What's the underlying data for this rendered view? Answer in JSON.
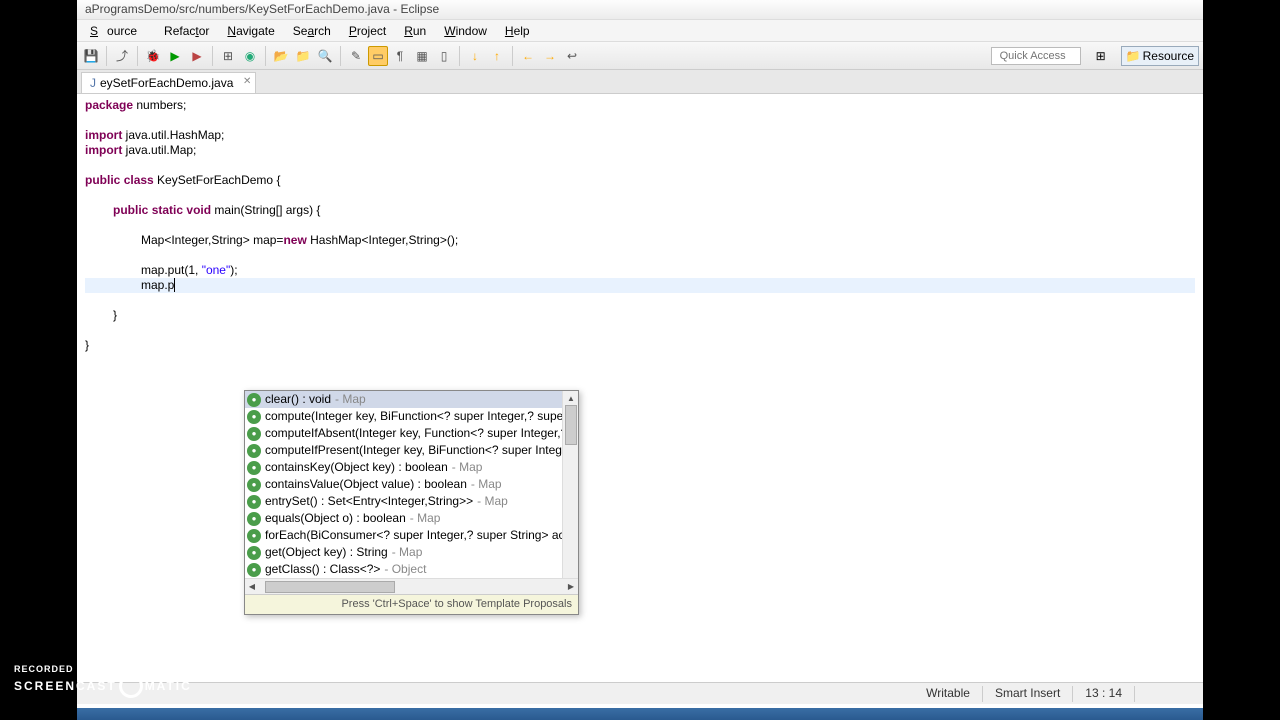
{
  "title": "aProgramsDemo/src/numbers/KeySetForEachDemo.java - Eclipse",
  "menus": [
    "Source",
    "Refactor",
    "Navigate",
    "Search",
    "Project",
    "Run",
    "Window",
    "Help"
  ],
  "quick_access_placeholder": "Quick Access",
  "perspective_label": "Resource",
  "tab": {
    "label": "eySetForEachDemo.java"
  },
  "code": {
    "l1": {
      "a": "package",
      "b": " numbers;"
    },
    "l2": {
      "a": "import",
      "b": " java.util.HashMap;"
    },
    "l3": {
      "a": "import",
      "b": " java.util.Map;"
    },
    "l4": {
      "a": "public",
      "b": " ",
      "c": "class",
      "d": " KeySetForEachDemo {"
    },
    "l5": {
      "a": "public",
      "b": " ",
      "c": "static",
      "d": " ",
      "e": "void",
      "f": " main(String[] args) {"
    },
    "l6": {
      "a": "Map<Integer,String> map=",
      "b": "new",
      "c": " HashMap<Integer,String>();"
    },
    "l7": {
      "a": "map.put(1, ",
      "b": "\"one\"",
      "c": ");"
    },
    "l8": {
      "a": "map.p"
    },
    "l9": "}",
    "l10": "}"
  },
  "completions": [
    {
      "sig": "clear() : void",
      "type": " - Map",
      "sel": true
    },
    {
      "sig": "compute(Integer key, BiFunction<? super Integer,? super",
      "type": ""
    },
    {
      "sig": "computeIfAbsent(Integer key, Function<? super Integer,?",
      "type": ""
    },
    {
      "sig": "computeIfPresent(Integer key, BiFunction<? super Integer",
      "type": ""
    },
    {
      "sig": "containsKey(Object key) : boolean",
      "type": " - Map"
    },
    {
      "sig": "containsValue(Object value) : boolean",
      "type": " - Map"
    },
    {
      "sig": "entrySet() : Set<Entry<Integer,String>>",
      "type": " - Map"
    },
    {
      "sig": "equals(Object o) : boolean",
      "type": " - Map"
    },
    {
      "sig": "forEach(BiConsumer<? super Integer,? super String> actio",
      "type": ""
    },
    {
      "sig": "get(Object key) : String",
      "type": " - Map"
    },
    {
      "sig": "getClass() : Class<?>",
      "type": " - Object"
    }
  ],
  "popup_hint": "Press 'Ctrl+Space' to show Template Proposals",
  "status": {
    "writable": "Writable",
    "insert": "Smart Insert",
    "pos": "13 : 14"
  },
  "watermark": {
    "top": "RECORDED WITH",
    "a": "SCREENCAST",
    "b": "MATIC"
  }
}
